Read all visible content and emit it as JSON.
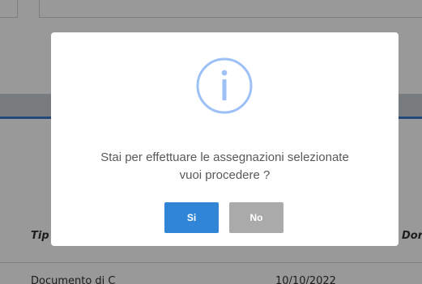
{
  "background": {
    "table_header": {
      "col_left": "Tip",
      "col_right": "Dor"
    },
    "table_row": {
      "cell_a": "Documento di C",
      "cell_b": "10/10/2022"
    }
  },
  "dialog": {
    "icon": "info-circle-icon",
    "message_line1": "Stai per effettuare le assegnazioni selezionate",
    "message_line2": "vuoi procedere ?",
    "confirm_label": "Si",
    "cancel_label": "No"
  },
  "colors": {
    "icon": "#9dc0f7",
    "confirm_button": "#3085d6",
    "cancel_button": "#aaaaaa",
    "section_bar_accent": "#3a7bc8"
  }
}
